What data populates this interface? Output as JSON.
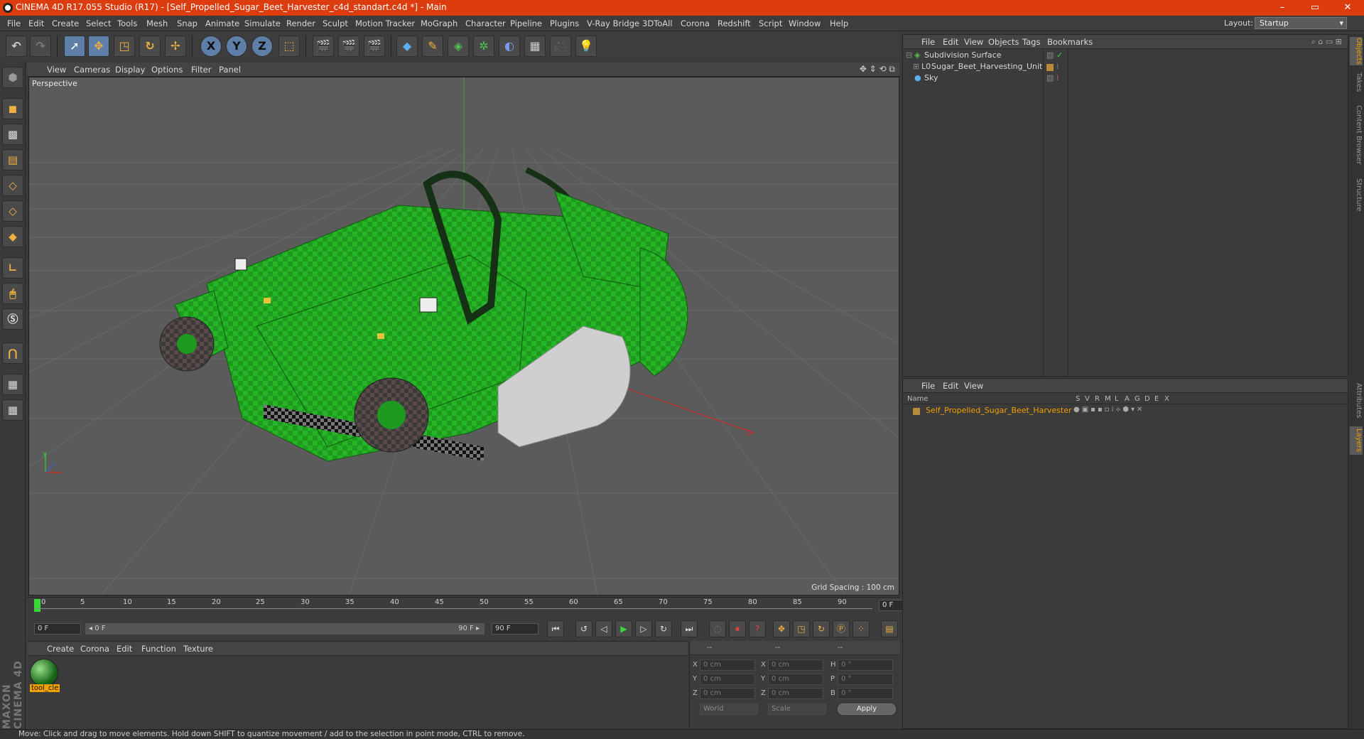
{
  "app": {
    "title": "CINEMA 4D R17.055 Studio (R17) - [Self_Propelled_Sugar_Beet_Harvester_c4d_standart.c4d *] - Main",
    "window_controls": [
      "–",
      "▭",
      "✕"
    ]
  },
  "menubar": {
    "items": [
      "File",
      "Edit",
      "Create",
      "Select",
      "Tools",
      "Mesh",
      "Snap",
      "Animate",
      "Simulate",
      "Render",
      "Sculpt",
      "Motion Tracker",
      "MoGraph",
      "Character",
      "Pipeline",
      "Plugins",
      "V-Ray Bridge",
      "3DToAll",
      "Corona",
      "Redshift",
      "Script",
      "Window",
      "Help"
    ],
    "layout_label": "Layout:",
    "layout_value": "Startup"
  },
  "toolbar": {
    "xyz": [
      "X",
      "Y",
      "Z"
    ]
  },
  "viewport": {
    "menu": [
      "View",
      "Cameras",
      "Display",
      "Options",
      "Filter",
      "Panel"
    ],
    "label": "Perspective",
    "grid_spacing": "Grid Spacing : 100 cm",
    "axis_y": "y",
    "axis_z": "z"
  },
  "timeline": {
    "ticks": [
      "0",
      "5",
      "10",
      "15",
      "20",
      "25",
      "30",
      "35",
      "40",
      "45",
      "50",
      "55",
      "60",
      "65",
      "70",
      "75",
      "80",
      "85",
      "90"
    ],
    "current_frame": "0 F"
  },
  "playbar": {
    "start": "0 F",
    "range_start": "◂ 0 F",
    "range_end": "90 F ▸",
    "end": "90 F"
  },
  "material_manager": {
    "menu": [
      "Create",
      "Corona",
      "Edit",
      "Function",
      "Texture"
    ],
    "material_name": "tool_cle"
  },
  "coordinates": {
    "header": [
      "--",
      "--",
      "--"
    ],
    "rows": [
      {
        "a": "X",
        "av": "0 cm",
        "b": "X",
        "bv": "0 cm",
        "c": "H",
        "cv": "0 °"
      },
      {
        "a": "Y",
        "av": "0 cm",
        "b": "Y",
        "bv": "0 cm",
        "c": "P",
        "cv": "0 °"
      },
      {
        "a": "Z",
        "av": "0 cm",
        "b": "Z",
        "bv": "0 cm",
        "c": "B",
        "cv": "0 °"
      }
    ],
    "world": "World",
    "scale": "Scale",
    "apply": "Apply"
  },
  "object_manager": {
    "menu": [
      "File",
      "Edit",
      "View",
      "Objects",
      "Tags",
      "Bookmarks"
    ],
    "objects": [
      "Subdivision Surface",
      "Sugar_Beet_Harvesting_Unit",
      "Sky"
    ]
  },
  "layer_manager": {
    "menu": [
      "File",
      "Edit",
      "View"
    ],
    "columns": [
      "Name",
      "S",
      "V",
      "R",
      "M",
      "L",
      "A",
      "G",
      "D",
      "E",
      "X"
    ],
    "layer_name": "Self_Propelled_Sugar_Beet_Harvester"
  },
  "right_tabs": [
    "Objects",
    "Takes",
    "Content Browser",
    "Structure",
    "Attributes",
    "Layers"
  ],
  "brand": "MAXON CINEMA 4D",
  "status": "Move: Click and drag to move elements. Hold down SHIFT to quantize movement / add to the selection in point mode, CTRL to remove.",
  "colors": {
    "titlebar": "#dc3c0e",
    "harvester_green": "#1f9a1f",
    "accent_orange": "#e9a53a",
    "selection_blue": "#5d7fa8"
  }
}
